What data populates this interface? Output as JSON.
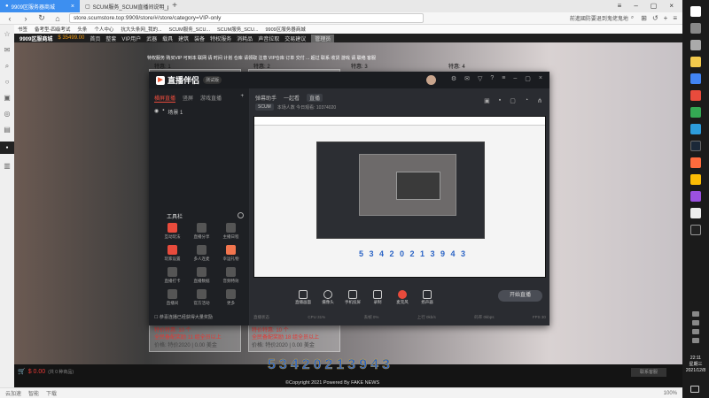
{
  "browser": {
    "tabs": [
      {
        "title": "9909区服务器商城",
        "active": true
      },
      {
        "title": "SCUM服务_SCUM直播间说明_p...",
        "active": false
      }
    ],
    "url": "store.scumstore.top:9909/store/#/store/category=VIP-only",
    "search_text": "前進國防要退到鬼佬鬼地",
    "bookmarks": [
      "书签",
      "备考型-四级考试",
      "头条",
      "个人中心",
      "抗大头条网_我的...",
      "SCUM服务_SCU...",
      "SCUM服务_SCU...",
      "9909区服务器商城"
    ]
  },
  "site": {
    "header": {
      "logo": "9909区服商城",
      "money": "$ 35499.00",
      "nav": [
        "首页",
        "整套",
        "VIP用户",
        "武器",
        "载具",
        "建筑",
        "装备",
        "特权服务",
        "消耗品",
        "声音拉取",
        "交易建议"
      ],
      "badge": "管理员"
    },
    "notice": "特权服务 购买VIP 可到本 联网 请 时间 计划 仓库 请领取 注意 VIP仓库 订单 交付 ... 超过 联系 收货 游戏 请 联络 客服",
    "card_labels": [
      "特惠: 1",
      "特惠: 2",
      "特惠: 3",
      "特惠: 4"
    ],
    "price_rows": [
      {
        "line1": "特价特惠: 10 个",
        "line2": "全民备配奖励 11 组全员以上",
        "line3": "价格: 特价2020 | 0.00 美金"
      },
      {
        "line1": "特价特惠: 10 个",
        "line2": "全民备配奖励 18 组全员以上",
        "line3": "价格: 特价2020 | 0.00 美金"
      }
    ]
  },
  "app": {
    "name": "直播伴侣",
    "version": "测试版",
    "left_tabs": [
      "横屏直播",
      "竖屏",
      "游戏直播"
    ],
    "scene": "场景 1",
    "tools_title": "工具栏",
    "tools": [
      {
        "label": "互动玩法",
        "color": "red"
      },
      {
        "label": "直播分享",
        "color": "gray"
      },
      {
        "label": "主播日程",
        "color": "gray"
      },
      {
        "label": "玩家设置",
        "color": "red"
      },
      {
        "label": "多人连麦",
        "color": "gray"
      },
      {
        "label": "幸运礼物",
        "color": "orange"
      },
      {
        "label": "直播打卡",
        "color": "gray"
      },
      {
        "label": "直播数据",
        "color": "gray"
      },
      {
        "label": "音频特效",
        "color": "gray"
      },
      {
        "label": "直播间",
        "color": "gray"
      },
      {
        "label": "官方活动",
        "color": "gray"
      },
      {
        "label": "更多",
        "color": "gray"
      }
    ],
    "left_footer": "☐ 恭喜连播已经获得大量奖励",
    "top_tabs": [
      "弹幕助手",
      "一起看",
      "直播"
    ],
    "stream_tag": "SCUM",
    "stream_info": "本场人数 今日观看: 10374020",
    "preview_number": "5 3 4 2 0 2 1 3 9 4 3",
    "bottom_tools": [
      "直播画面",
      "摄像头",
      "手机投屏",
      "录制",
      "麦克风",
      "扬声器"
    ],
    "start_button": "开始直播",
    "status": [
      "直播状态",
      "CPU 31%",
      "丢帧 0%",
      "上行 0kb/s",
      "码率 0kbps",
      "FPS 30"
    ]
  },
  "footer": {
    "cart_amount": "$ 0.00",
    "cart_sub": "(共 0 种商品)",
    "big_number": "53420213943",
    "copyright": "©Copyright 2021 Powered By FAKE NEWS",
    "chat": "联系客服"
  },
  "statusbar": {
    "items": [
      "云加速",
      "智能",
      "下载"
    ],
    "zoom": "100%"
  },
  "system": {
    "time": "22:11",
    "weekday": "星期三",
    "date": "2021/12/8"
  }
}
